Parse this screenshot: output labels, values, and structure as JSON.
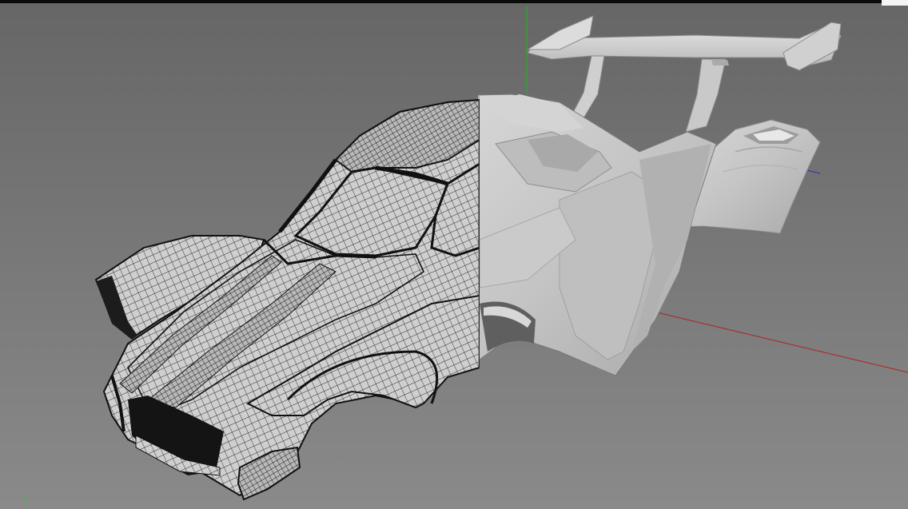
{
  "viewport": {
    "axis_label": "Y",
    "colors": {
      "background_top": "#6b6b6b",
      "background_bottom": "#858585",
      "axis_y": "#2fa82f",
      "axis_x": "#b02020",
      "axis_z": "#2030c0",
      "mesh_fill": "#d2d2d2",
      "wire": "#1e1e1e",
      "shaded_body": "#c7c7c7"
    },
    "objects": [
      "car-body-wireframe",
      "car-body-shaded",
      "rear-wing",
      "fender-panel"
    ]
  }
}
